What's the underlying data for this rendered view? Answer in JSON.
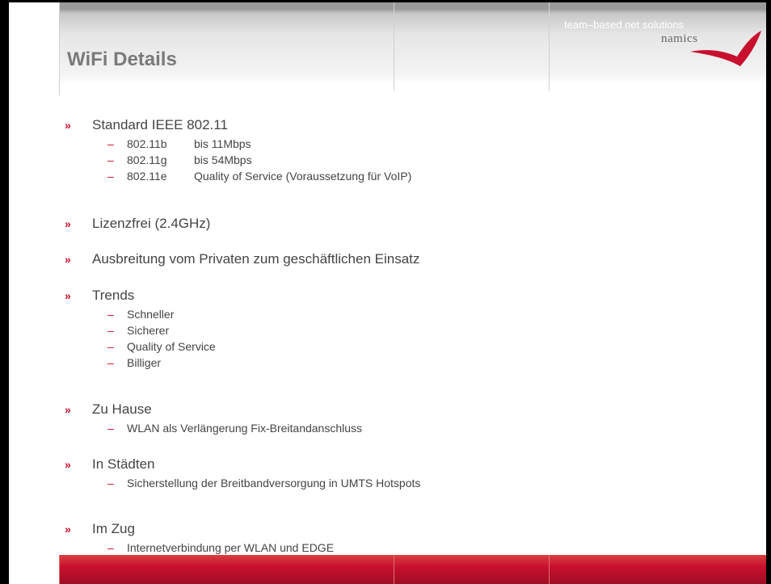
{
  "slide": {
    "title": "WiFi Details",
    "logo_text": "namics",
    "footer_text": "team–based net solutions"
  },
  "bullet_marker": "»",
  "dash_marker": "–",
  "sections": [
    {
      "text": "Standard IEEE 802.11",
      "items": [
        {
          "label": "802.11b",
          "detail": "bis 11Mbps"
        },
        {
          "label": "802.11g",
          "detail": "bis 54Mbps"
        },
        {
          "label": "802.11e",
          "detail": "Quality of Service (Voraussetzung für VoIP)"
        }
      ]
    },
    {
      "text": "Lizenzfrei (2.4GHz)",
      "items": []
    },
    {
      "text": "Ausbreitung vom Privaten zum geschäftlichen Einsatz",
      "items": []
    },
    {
      "text": "Trends",
      "items": [
        {
          "label": "Schneller"
        },
        {
          "label": "Sicherer"
        },
        {
          "label": "Quality of Service"
        },
        {
          "label": "Billiger"
        }
      ]
    },
    {
      "text": "Zu Hause",
      "items": [
        {
          "label": "WLAN als Verlängerung Fix-Breitandanschluss"
        }
      ]
    },
    {
      "text": "In Städten",
      "items": [
        {
          "label": "Sicherstellung der Breitbandversorgung in UMTS Hotspots"
        }
      ]
    },
    {
      "text": "Im Zug",
      "items": [
        {
          "label": "Internetverbindung per WLAN und EDGE"
        }
      ]
    }
  ],
  "colors": {
    "accent_red": "#c8102e",
    "title_gray": "#7a7a7a",
    "body_text": "#444444"
  }
}
